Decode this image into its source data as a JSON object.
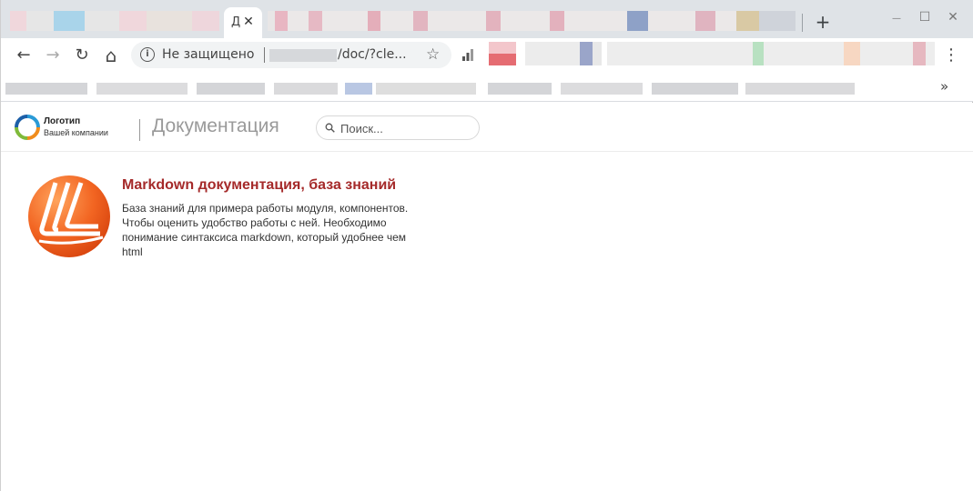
{
  "browser": {
    "active_tab_char": "Д",
    "tab_close": "✕",
    "new_tab": "+",
    "window_controls": {
      "minimize": "—",
      "maximize": "☐",
      "close": "✕"
    },
    "nav": {
      "back": "←",
      "forward": "→",
      "reload": "↻",
      "home": "⌂"
    },
    "address": {
      "insecure_label": "Не защищено",
      "path": "/doc/?cle..."
    },
    "star": "☆",
    "menu": "⋮",
    "bookmarks_more": "»"
  },
  "site": {
    "logo": {
      "title": "Логотип",
      "subtitle": "Вашей компании"
    },
    "header_title": "Документация",
    "search": {
      "placeholder": "Поиск..."
    }
  },
  "card": {
    "title": "Markdown документация, база знаний",
    "description": "База знаний для примера работы модуля, компонентов. Чтобы оценить удобство работы с ней. Необходимо понимание синтаксиса markdown, который удобнее чем html"
  },
  "colors": {
    "accent_title": "#a52a2a",
    "logo_orange": "#f26522",
    "tabstrip_bg": "#dfe3e7"
  }
}
